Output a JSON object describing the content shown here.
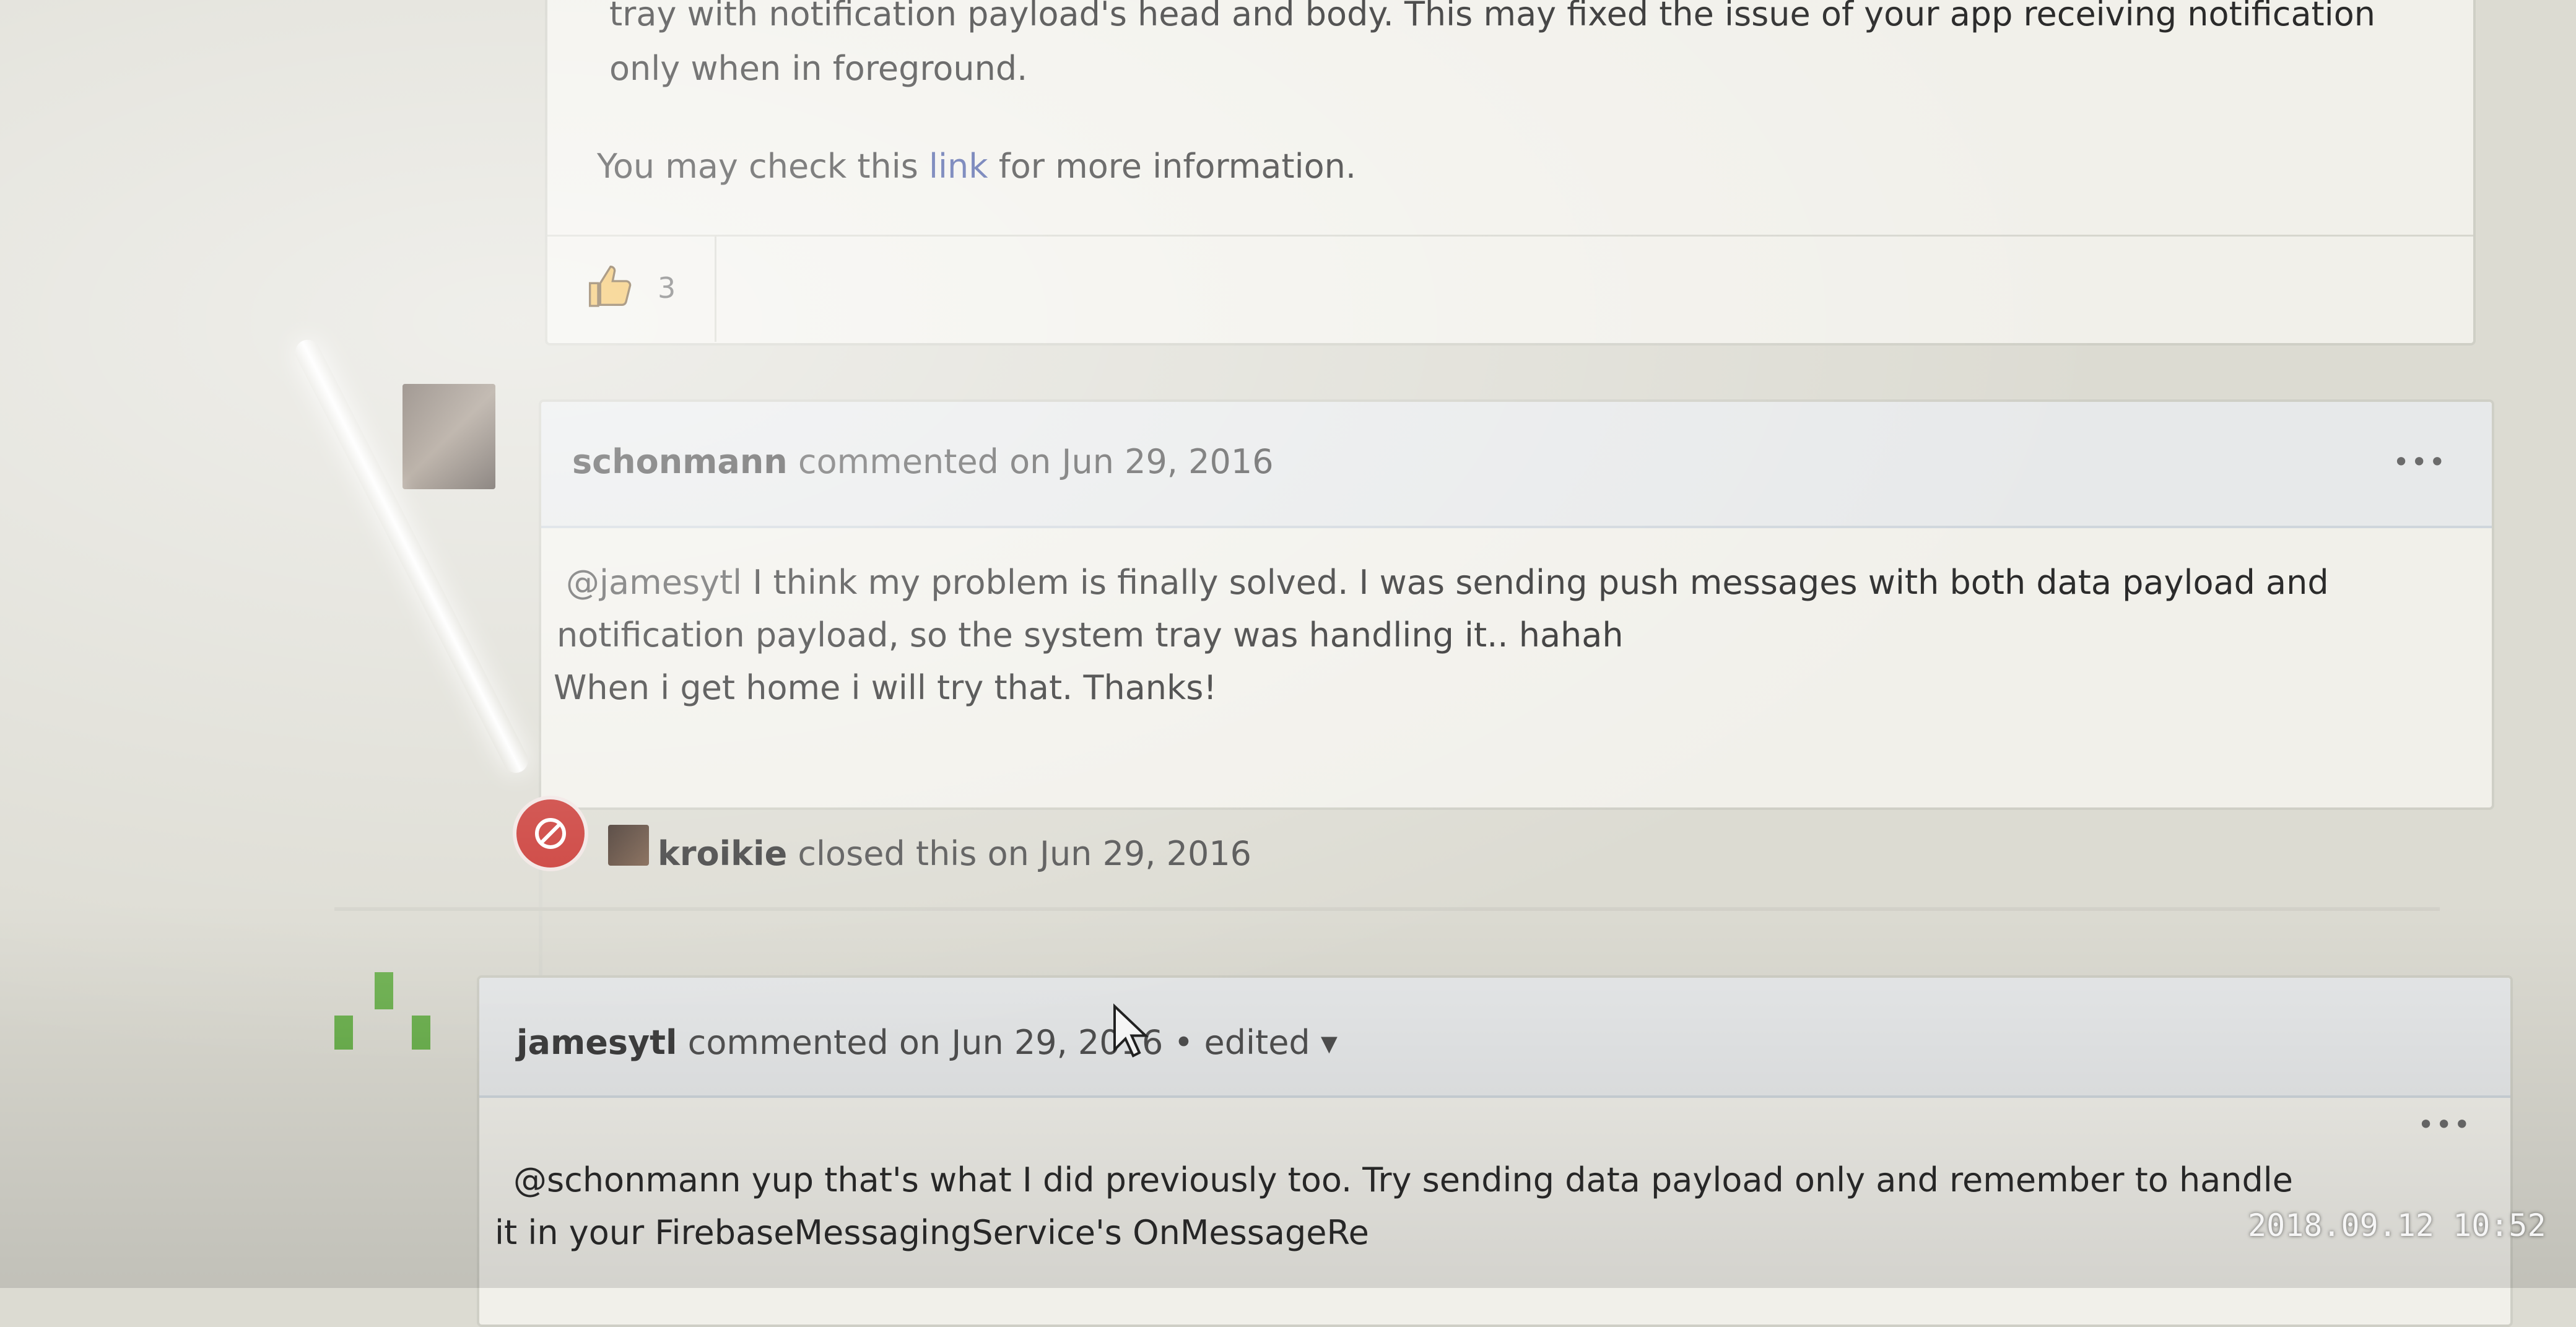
{
  "comment_top": {
    "line1": "tray with notification payload's head and body. This may fixed the issue of your app receiving notification",
    "line2": "only when in foreground.",
    "line3_pre": "You may check this ",
    "line3_link": "link",
    "line3_post": " for more information.",
    "reaction_count": "3"
  },
  "comment_schonmann": {
    "author": "schonmann",
    "action": " commented on Jun 29, 2016",
    "more": "•••",
    "mention": "@jamesytl",
    "line1_rest": " I think my problem is finally solved. I was sending push messages with both data payload and",
    "line2": "notification payload, so the system tray was handling it.. hahah",
    "line3": "When i get home i will try that. Thanks!"
  },
  "event_closed": {
    "actor": "kroikie",
    "action": " closed this on Jun 29, 2016"
  },
  "comment_jamesytl": {
    "author": "jamesytl",
    "action": " commented on Jun 29, 2016",
    "edited": " • edited ▾",
    "more": "•••",
    "line1": "@schonmann yup that's what I did previously too. Try sending data payload only and remember to handle",
    "line2": "it in your FirebaseMessagingService's OnMessageRe"
  },
  "photo_timestamp": "2018.09.12 10:52",
  "colors": {
    "closed_badge": "#c8302b",
    "link": "#3a4e9c",
    "identicon_green": "#6ab04c"
  }
}
